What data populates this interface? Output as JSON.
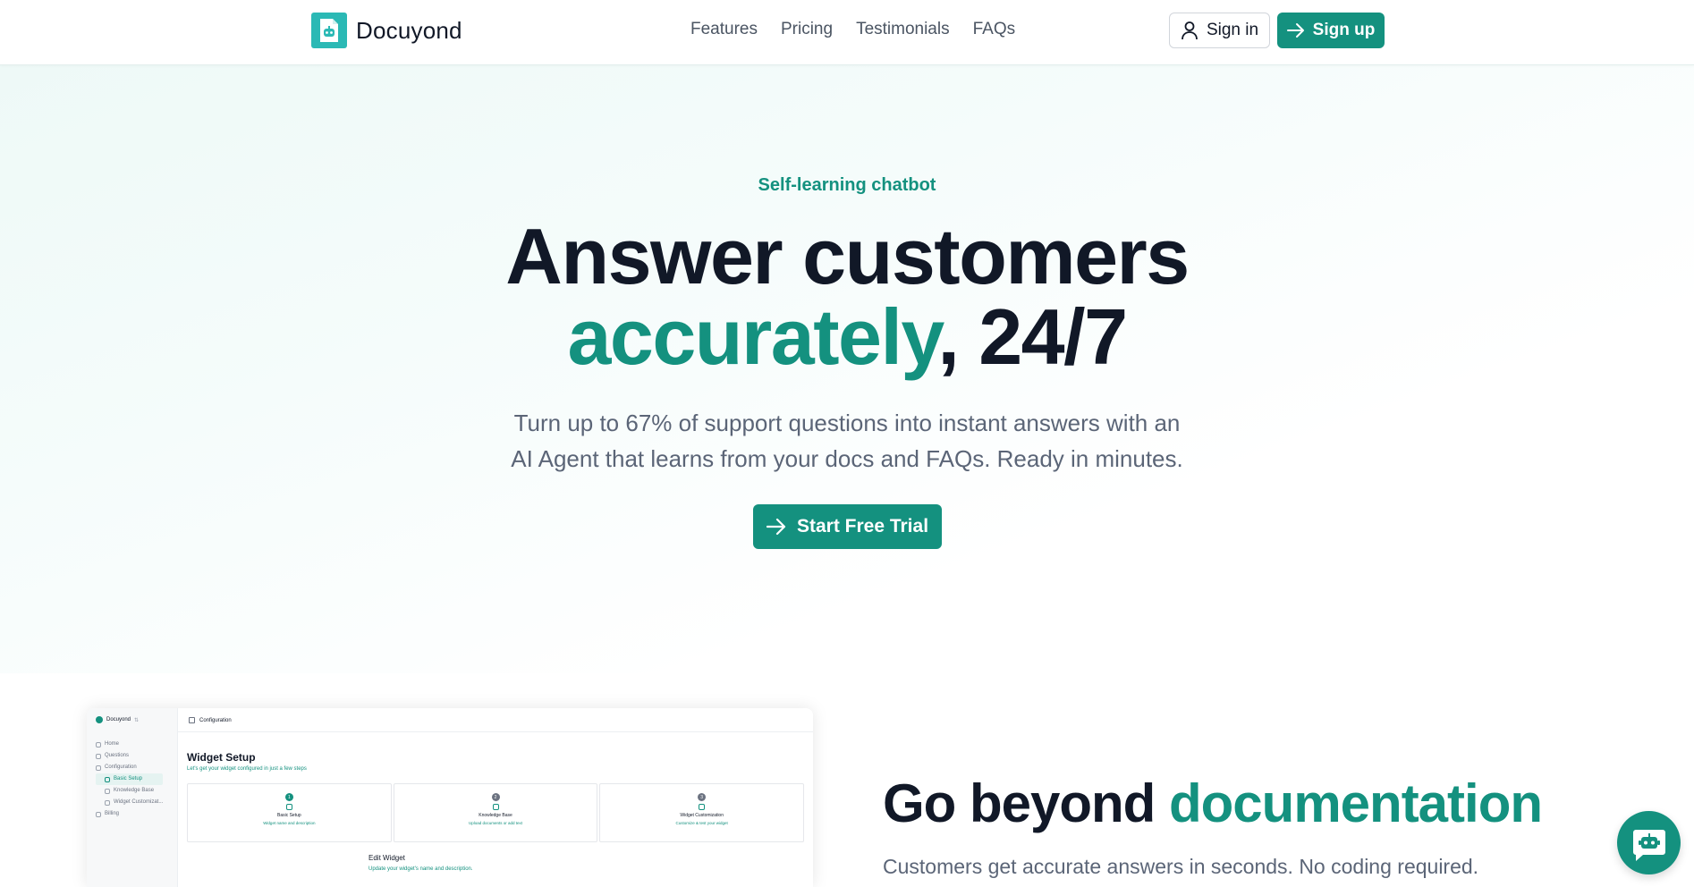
{
  "header": {
    "brand": "Docuyond",
    "nav": [
      "Features",
      "Pricing",
      "Testimonials",
      "FAQs"
    ],
    "signin_label": "Sign in",
    "signup_label": "Sign up"
  },
  "hero": {
    "eyebrow": "Self-learning chatbot",
    "title_line1": "Answer customers",
    "title_accent": "accurately",
    "title_rest": ", 24/7",
    "subtitle_line1": "Turn up to 67% of support questions into instant answers with an",
    "subtitle_line2": "AI Agent that learns from your docs and FAQs. Ready in minutes.",
    "cta_label": "Start Free Trial"
  },
  "preview": {
    "brand": "Docuyond",
    "nav": [
      "Home",
      "Questions",
      "Configuration"
    ],
    "subnav": [
      "Basic Setup",
      "Knowledge Base",
      "Widget Customizat..."
    ],
    "billing": "Billing",
    "topbar_title": "Configuration",
    "heading": "Widget Setup",
    "heading_sub": "Let's get your widget configured in just a few steps",
    "steps": [
      {
        "num": "1",
        "title": "Basic Setup",
        "desc": "Widget name and description"
      },
      {
        "num": "2",
        "title": "Knowledge Base",
        "desc": "Upload documents or add text"
      },
      {
        "num": "3",
        "title": "Widget Customization",
        "desc": "Customize & test your widget"
      }
    ],
    "edit_title": "Edit Widget",
    "edit_sub": "Update your widget's name and description."
  },
  "section2": {
    "title_main": "Go beyond ",
    "title_accent": "documentation",
    "subtitle": "Customers get accurate answers in seconds. No coding required."
  },
  "colors": {
    "accent": "#14917f",
    "logo": "#2bb9b5",
    "text": "#111827",
    "muted": "#5b6577"
  },
  "icons": {
    "logo": "document-bot-icon",
    "signin": "user-icon",
    "signup": "arrow-right-icon",
    "cta": "arrow-right-icon",
    "chat": "robot-chat-icon"
  }
}
